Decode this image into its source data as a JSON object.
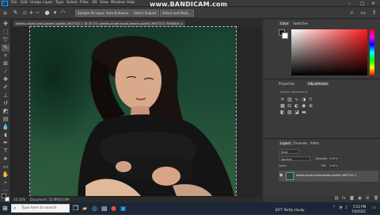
{
  "watermark": "www.BANDICAM.com",
  "menu": [
    "File",
    "Edit",
    "Image",
    "Layer",
    "Type",
    "Select",
    "Filter",
    "3D",
    "View",
    "Window",
    "Help"
  ],
  "options_bar": {
    "sample_all_layers": "Sample All Layers",
    "auto_enhance": "Auto-Enhance",
    "select_subject": "Select Subject",
    "select_and_mask": "Select and Mask..."
  },
  "document_tab": "pexels-angel-ayala-pexels-spotify-3847312-1 @ 33.3% (pexels-angel-ayala-pexels-spotify-3847312, RGB/8#) ×",
  "status_bar": {
    "zoom": "33.33%",
    "doc": "Document: 33.9M/24.8M"
  },
  "panels": {
    "color_tab": "Color",
    "swatches_tab": "Swatches",
    "properties_tab": "Properties",
    "adjustments_tab": "Adjustments",
    "add_adjustment": "Add an adjustment",
    "layers_tab": "Layers",
    "channels_tab": "Channels",
    "paths_tab": "Paths",
    "kind": "Kind",
    "blend": "Normal",
    "opacity_label": "Opacity:",
    "opacity": "100%",
    "lock_label": "Lock:",
    "fill_label": "Fill:",
    "fill": "100%",
    "layer_name": "pexels-angel-ayala-pexels-spotify-3847312-1"
  },
  "taskbar": {
    "search_placeholder": "Type here to search",
    "weather": "83°F Partly cloudy",
    "time": "5:52 PM",
    "date": "7/4/2022"
  },
  "colors": {
    "foreground": "#1a1a1a",
    "background": "#ffffff",
    "accent": "#2680eb"
  }
}
